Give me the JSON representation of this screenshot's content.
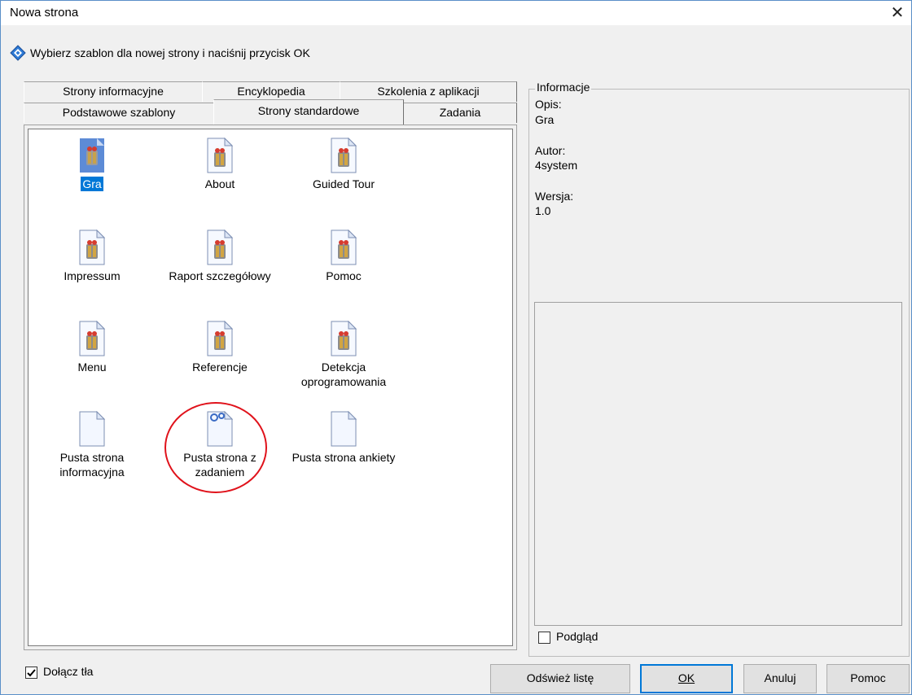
{
  "window": {
    "title": "Nowa strona",
    "close_symbol": "✕"
  },
  "instruction": {
    "text": "Wybierz szablon dla nowej strony i naciśnij przycisk OK",
    "icon": "diamond-info-icon"
  },
  "tabs": {
    "back_row": [
      {
        "label": "Strony informacyjne"
      },
      {
        "label": "Encyklopedia"
      },
      {
        "label": "Szkolenia z aplikacji"
      }
    ],
    "front_row": [
      {
        "label": "Podstawowe szablony"
      },
      {
        "label": "Strony standardowe",
        "selected": true
      },
      {
        "label": "Zadania"
      }
    ]
  },
  "templates": [
    {
      "label": "Gra",
      "icon": "game-page-icon",
      "selected": true
    },
    {
      "label": "About",
      "icon": "page-icon"
    },
    {
      "label": "Guided Tour",
      "icon": "page-icon"
    },
    {
      "label": "Impressum",
      "icon": "page-icon"
    },
    {
      "label": "Raport szczegółowy",
      "icon": "page-icon"
    },
    {
      "label": "Pomoc",
      "icon": "page-icon"
    },
    {
      "label": "Menu",
      "icon": "page-icon"
    },
    {
      "label": "Referencje",
      "icon": "page-icon"
    },
    {
      "label_line1": "Detekcja",
      "label_line2": "oprogramowania",
      "icon": "page-icon"
    },
    {
      "label_line1": "Pusta strona",
      "label_line2": "informacyjna",
      "icon": "blank-page-icon"
    },
    {
      "label_line1": "Pusta strona z",
      "label_line2": "zadaniem",
      "icon": "blank-task-page-icon"
    },
    {
      "label": "Pusta strona ankiety",
      "icon": "blank-page-icon"
    }
  ],
  "info": {
    "legend": "Informacje",
    "description_label": "Opis:",
    "description_value": "Gra",
    "author_label": "Autor:",
    "author_value": "4system",
    "version_label": "Wersja:",
    "version_value": "1.0",
    "preview_label": "Podgląd",
    "preview_checked": false
  },
  "footer": {
    "include_backgrounds_label": "Dołącz tła",
    "include_backgrounds_checked": true,
    "refresh_button": "Odśwież listę",
    "ok_button": "OK",
    "cancel_button": "Anuluj",
    "help_button": "Pomoc"
  },
  "colors": {
    "selection": "#0078d7",
    "annotation": "#e0121b",
    "border_accent": "#5a8fc8"
  }
}
